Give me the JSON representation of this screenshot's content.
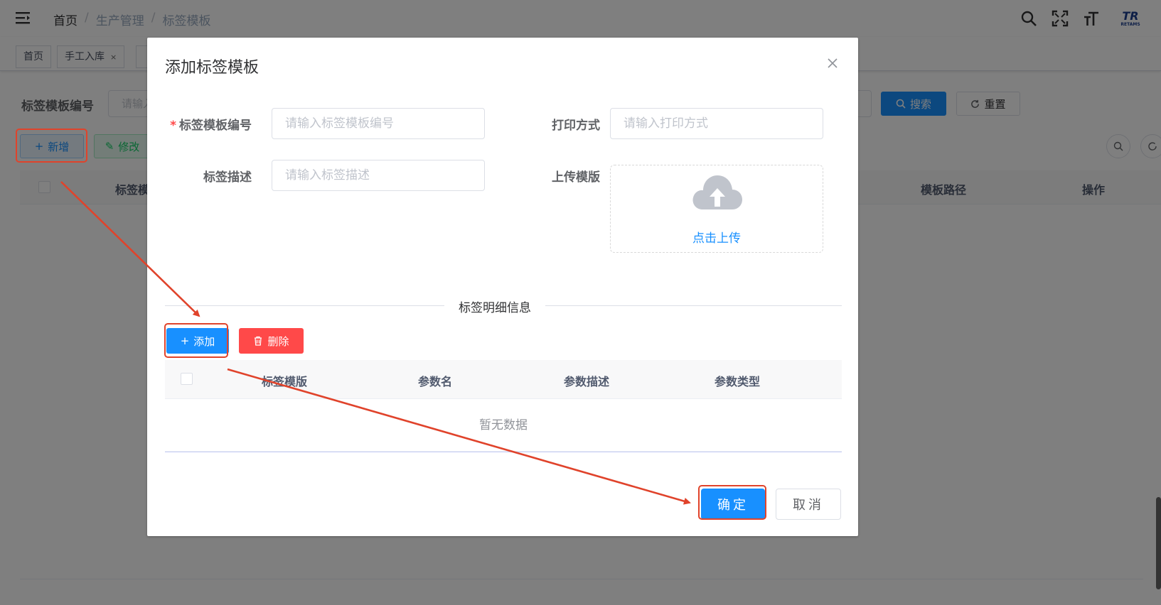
{
  "navbar": {
    "breadcrumb": [
      "首页",
      "生产管理",
      "标签模板"
    ],
    "separator": "/",
    "logo_text": "TR",
    "logo_sub": "RETAMS"
  },
  "tags": [
    {
      "label": "首页"
    },
    {
      "label": "手工入库",
      "close": "×"
    }
  ],
  "query": {
    "label": "标签模板编号",
    "placeholder": "请输入",
    "search_label": "搜索",
    "reset_label": "重置"
  },
  "toolbar": {
    "add_label": "新增",
    "edit_label": "修改"
  },
  "table": {
    "columns": [
      "标签模",
      "模板路径",
      "操作"
    ]
  },
  "dialog": {
    "title": "添加标签模板",
    "fields": {
      "code_label": "标签模板编号",
      "code_required": "*",
      "code_placeholder": "请输入标签模板编号",
      "print_label": "打印方式",
      "print_placeholder": "请输入打印方式",
      "desc_label": "标签描述",
      "desc_placeholder": "请输入标签描述",
      "upload_label": "上传模版",
      "upload_text": "点击上传"
    },
    "section_title": "标签明细信息",
    "add_label": "添加",
    "delete_label": "删除",
    "detail_columns": [
      "标签模版",
      "参数名",
      "参数描述",
      "参数类型"
    ],
    "empty_text": "暂无数据",
    "confirm_label": "确定",
    "cancel_label": "取消"
  },
  "colors": {
    "primary": "#1890ff",
    "danger": "#ff4949",
    "success": "#13ce66",
    "annotation": "#e0432b"
  }
}
